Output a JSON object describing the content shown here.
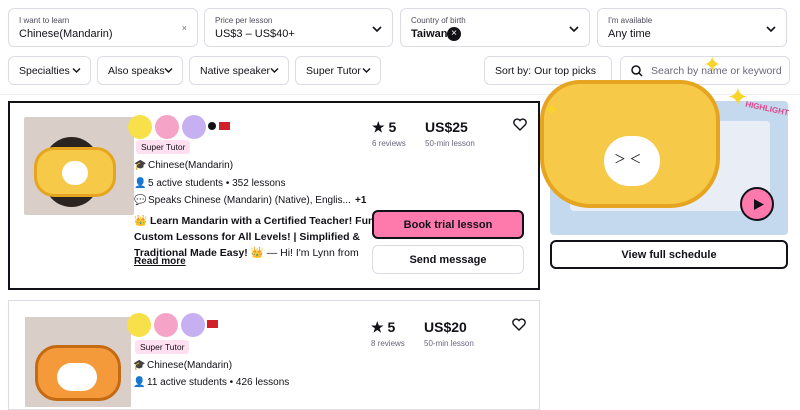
{
  "filters": {
    "learn": {
      "label": "I want to learn",
      "value": "Chinese(Mandarin)"
    },
    "price": {
      "label": "Price per lesson",
      "value": "US$3 – US$40+"
    },
    "country": {
      "label": "Country of birth",
      "value": "Taiwan"
    },
    "available": {
      "label": "I'm available",
      "value": "Any time"
    }
  },
  "pills": {
    "specialties": "Specialties",
    "also_speaks": "Also speaks",
    "native": "Native speaker",
    "super_tutor": "Super Tutor",
    "sort": "Sort by: Our top picks",
    "search_placeholder": "Search by name or keyword"
  },
  "tutors": [
    {
      "badge": "Super Tutor",
      "language": "Chinese(Mandarin)",
      "students": "5 active students • 352 lessons",
      "speaks": "Speaks Chinese (Mandarin) (Native), Englis...",
      "speaks_more": "+1",
      "rating": "5",
      "reviews": "6 reviews",
      "price": "US$25",
      "duration": "50-min lesson",
      "desc_line1": "Learn Mandarin with a Certified Teacher! Fun,",
      "desc_line2": "Custom Lessons for All Levels! | Simplified &",
      "desc_line3": "Traditional Made Easy!",
      "desc_line3b": "— Hi! I'm Lynn from",
      "read_more": "Read more",
      "book_label": "Book trial lesson",
      "message_label": "Send message"
    },
    {
      "badge": "Super Tutor",
      "language": "Chinese(Mandarin)",
      "students": "11 active students • 426 lessons",
      "rating": "5",
      "reviews": "8 reviews",
      "price": "US$20",
      "duration": "50-min lesson"
    }
  ],
  "video": {
    "schedule_label": "View full schedule",
    "sticker_text": "HIGHLIGHT"
  },
  "colors": {
    "pink": "#ff7aac",
    "border": "#dcdce5",
    "yellow": "#f7c948"
  }
}
